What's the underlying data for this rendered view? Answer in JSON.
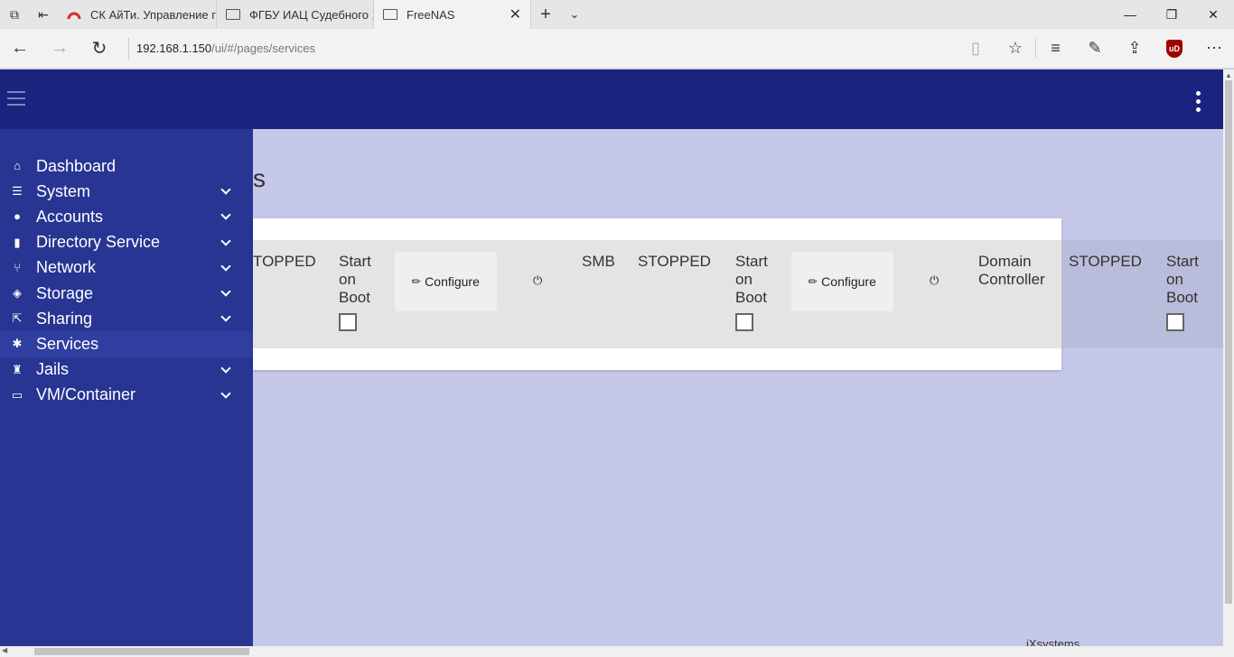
{
  "browser": {
    "tabs": [
      {
        "title": "СК АйТи. Управление г"
      },
      {
        "title": "ФГБУ ИАЦ Судебного ,"
      },
      {
        "title": "FreeNAS"
      }
    ],
    "new_tab_icon": "plus-icon",
    "url_host": "192.168.1.150",
    "url_path": "/ui/#/pages/services",
    "ublock_label": "uD"
  },
  "sidebar": {
    "items": [
      {
        "label": "Dashboard",
        "icon": "home-icon",
        "glyph": "⌂",
        "expandable": false
      },
      {
        "label": "System",
        "icon": "sliders-icon",
        "glyph": "☰",
        "expandable": true
      },
      {
        "label": "Accounts",
        "icon": "people-icon",
        "glyph": "👥",
        "expandable": true
      },
      {
        "label": "Directory Service",
        "icon": "book-icon",
        "glyph": "▮",
        "expandable": true
      },
      {
        "label": "Network",
        "icon": "network-icon",
        "glyph": "⑂",
        "expandable": true
      },
      {
        "label": "Storage",
        "icon": "cube-icon",
        "glyph": "◈",
        "expandable": true
      },
      {
        "label": "Sharing",
        "icon": "share-icon",
        "glyph": "⇱",
        "expandable": true
      },
      {
        "label": "Services",
        "icon": "gear-icon",
        "glyph": "✱",
        "expandable": false,
        "active": true
      },
      {
        "label": "Jails",
        "icon": "jail-icon",
        "glyph": "♜",
        "expandable": true
      },
      {
        "label": "VM/Container",
        "icon": "monitor-icon",
        "glyph": "▭",
        "expandable": true
      }
    ]
  },
  "main": {
    "page_title": "s",
    "services_row": {
      "col1_status": "TOPPED",
      "start_on_boot_label": "Start on Boot",
      "configure_label": "Configure",
      "smb_name": "SMB",
      "smb_status": "STOPPED",
      "dc_name": "Domain Controller",
      "dc_status": "STOPPED"
    }
  },
  "footer": {
    "text": "iXsystems"
  }
}
